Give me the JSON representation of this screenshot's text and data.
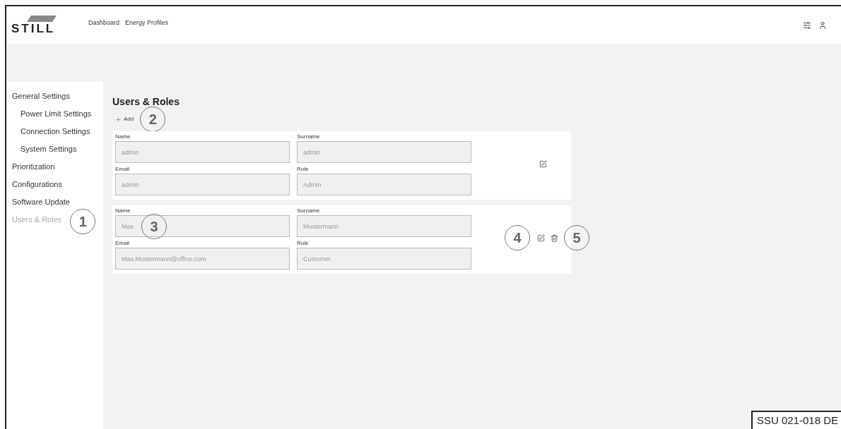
{
  "header": {
    "logo": "STILL",
    "nav": [
      {
        "label": "Dashboard",
        "selected": false
      },
      {
        "label": "Energy Profiles",
        "selected": false
      }
    ]
  },
  "sidebar": {
    "items": [
      {
        "label": "General Settings",
        "selected": false,
        "children": [
          {
            "label": "Power Limit Settings",
            "selected": false
          },
          {
            "label": "Connection Settings",
            "selected": false
          },
          {
            "label": "System Settings",
            "selected": false
          }
        ]
      },
      {
        "label": "Prioritization",
        "selected": false
      },
      {
        "label": "Configurations",
        "selected": false
      },
      {
        "label": "Software Update",
        "selected": false
      },
      {
        "label": "Users & Roles",
        "selected": true,
        "callout": "1"
      }
    ]
  },
  "content": {
    "title": "Users & Roles",
    "add_button": {
      "label": "Add",
      "callout": "2"
    },
    "users": [
      {
        "fields": [
          {
            "label": "Name",
            "value": "admin"
          },
          {
            "label": "Surname",
            "value": "admin"
          },
          {
            "label": "Email",
            "value": "admin"
          },
          {
            "label": "Role",
            "value": "Admin"
          }
        ],
        "deletable": false
      },
      {
        "fields": [
          {
            "label": "Name",
            "value": "Max",
            "callout": "3"
          },
          {
            "label": "Surname",
            "value": "Mustermann"
          },
          {
            "label": "Email",
            "value": "Max.Mustermann@office.com"
          },
          {
            "label": "Role",
            "value": "Customer"
          }
        ],
        "deletable": true,
        "edit_callout": "4",
        "delete_callout": "5"
      }
    ]
  },
  "figure_code": "SSU 021-018 DE"
}
